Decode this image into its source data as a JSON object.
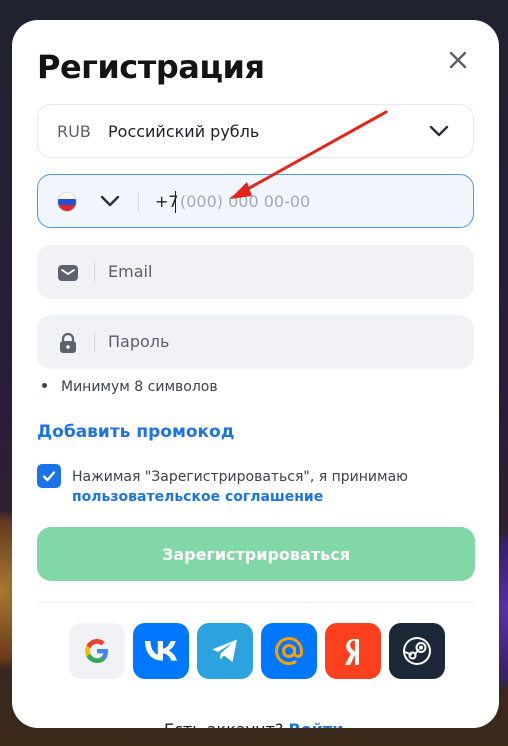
{
  "modal": {
    "title": "Регистрация",
    "close_icon": "close-icon"
  },
  "currency": {
    "code": "RUB",
    "name": "Российский рубль",
    "icon": "chevron-down-icon"
  },
  "phone": {
    "country_icon": "russia-flag-icon",
    "prefix": "+7",
    "placeholder": "(000) 000 00-00"
  },
  "email": {
    "icon": "mail-icon",
    "placeholder": "Email"
  },
  "password": {
    "icon": "lock-icon",
    "placeholder": "Пароль",
    "hint": "Минимум 8 символов"
  },
  "promo_link": "Добавить промокод",
  "agreement": {
    "checked": true,
    "text": "Нажимая \"Зарегистрироваться\", я принимаю",
    "link": "пользовательское соглашение"
  },
  "submit_label": "Зарегистрироваться",
  "social": [
    {
      "name": "google-icon",
      "color": "#f1f2f5"
    },
    {
      "name": "vk-icon",
      "color": "#0077ff"
    },
    {
      "name": "telegram-icon",
      "color": "#2aa3df"
    },
    {
      "name": "mailru-icon",
      "color": "#0077ff"
    },
    {
      "name": "yandex-icon",
      "color": "#fc3f1d"
    },
    {
      "name": "steam-icon",
      "color": "#1b2838"
    }
  ],
  "footer": {
    "text": "Есть аккаунт?",
    "link": "Войти"
  },
  "colors": {
    "accent": "#1a73e8",
    "submit_disabled": "#82d7a6",
    "annotation_arrow": "#e5231b"
  }
}
